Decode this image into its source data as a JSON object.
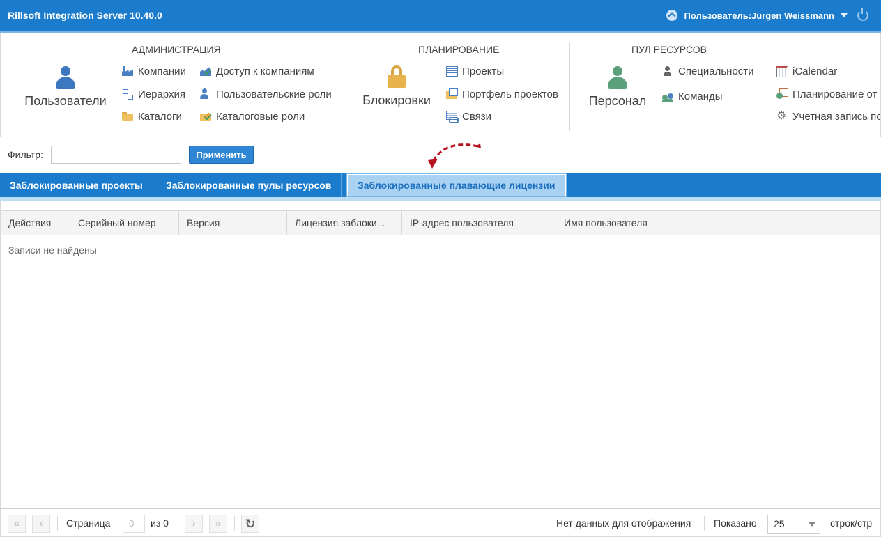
{
  "titlebar": {
    "app_title": "Rillsoft Integration Server 10.40.0",
    "user_label": "Пользователь:Jürgen Weissmann"
  },
  "ribbon": {
    "administration": {
      "title": "АДМИНИСТРАЦИЯ",
      "big_button": "Пользователи",
      "items": [
        "Компании",
        "Доступ к компаниям",
        "Иерархия",
        "Пользовательские роли",
        "Каталоги",
        "Каталоговые роли"
      ]
    },
    "planning": {
      "title": "ПЛАНИРОВАНИЕ",
      "big_button": "Блокировки",
      "items": [
        "Проекты",
        "Портфель проектов",
        "Связи"
      ]
    },
    "resource_pool": {
      "title": "ПУЛ РЕСУРСОВ",
      "big_button": "Персонал",
      "items": [
        "Специальности",
        "Команды"
      ]
    },
    "extra": {
      "items": [
        "iCalendar",
        "Планирование от",
        "Учетная запись по"
      ]
    }
  },
  "filter": {
    "label": "Фильтр:",
    "value": "",
    "apply_label": "Применить"
  },
  "tabs": [
    {
      "label": "Заблокированные проекты",
      "active": false
    },
    {
      "label": "Заблокированные пулы ресурсов",
      "active": false
    },
    {
      "label": "Заблокированные плавающие лицензии",
      "active": true
    }
  ],
  "grid": {
    "columns": [
      "Действия",
      "Серийный номер",
      "Версия",
      "Лицензия заблоки...",
      "IP-адрес пользователя",
      "Имя пользователя"
    ],
    "empty_message": "Записи не найдены"
  },
  "pager": {
    "page_label": "Страница",
    "page_value": "0",
    "of_label": "из 0",
    "no_data": "Нет данных для отображения",
    "shown_label": "Показано",
    "per_page": "25",
    "per_page_unit": "строк/стр"
  },
  "colors": {
    "brand": "#1b7ccd",
    "active_tab": "#a9d1f2",
    "annotation_arrow": "#b5121b"
  }
}
